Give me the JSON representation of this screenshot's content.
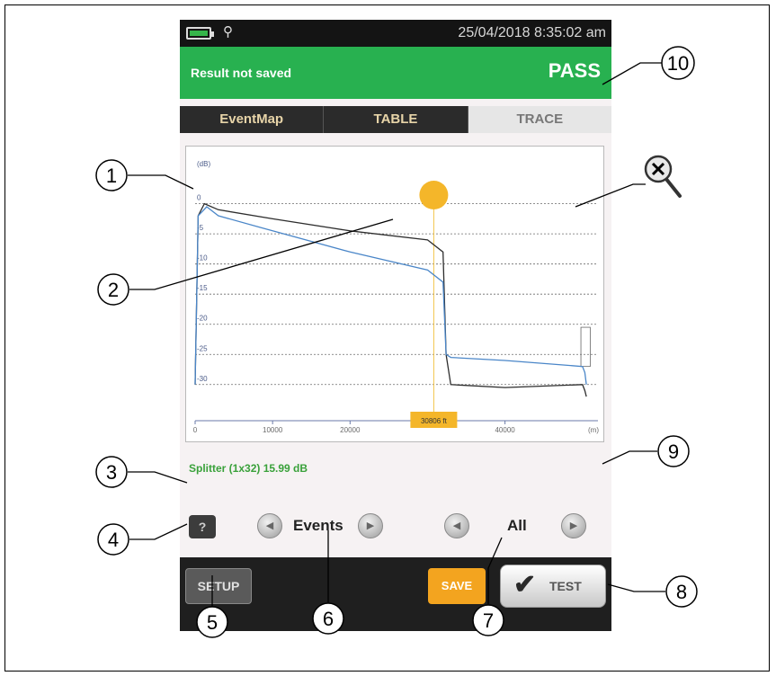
{
  "status_bar": {
    "datetime": "25/04/2018 8:35:02 am",
    "battery_icon": "battery-icon",
    "probe_icon": "probe-icon"
  },
  "result_bar": {
    "message": "Result not saved",
    "status": "PASS",
    "color": "#28b150"
  },
  "tabs": [
    {
      "label": "EventMap",
      "active": false
    },
    {
      "label": "TABLE",
      "active": false
    },
    {
      "label": "TRACE",
      "active": true
    }
  ],
  "chart_data": {
    "type": "line",
    "ylabel": "(dB)",
    "xlabel": "(m)",
    "y_ticks": [
      "0",
      "-5",
      "-10",
      "-15",
      "-20",
      "-25",
      "-30"
    ],
    "x_ticks": [
      "0",
      "10000",
      "20000",
      "40000"
    ],
    "ylim": [
      -36,
      8
    ],
    "xlim": [
      0,
      52000
    ],
    "cursor_position": "30806 ft",
    "cursor_x": 30806,
    "grid": true,
    "series": [
      {
        "color": "#2d2d2d",
        "x": [
          0,
          400,
          1200,
          3000,
          10000,
          20000,
          30000,
          32000,
          32400,
          33000,
          40000,
          50000,
          50300,
          50500
        ],
        "y": [
          -30,
          -2,
          0,
          -1,
          -2.5,
          -4.5,
          -6,
          -8,
          -25,
          -30,
          -30.5,
          -30,
          -31,
          -32
        ]
      },
      {
        "color": "#4a86c8",
        "x": [
          0,
          400,
          1500,
          3000,
          10000,
          20000,
          30000,
          32000,
          32400,
          33000,
          40000,
          50000,
          50300,
          50500
        ],
        "y": [
          -30,
          -2,
          -0.5,
          -2,
          -4.5,
          -8,
          -11,
          -13,
          -25,
          -25.5,
          -26,
          -27,
          -28,
          -30
        ]
      }
    ]
  },
  "event_info": "Splitter (1x32) 15.99 dB",
  "controls": {
    "help_label": "?",
    "events_label": "Events",
    "all_label": "All",
    "prev_icon": "chevron-left-icon",
    "next_icon": "chevron-right-icon"
  },
  "bottom_bar": {
    "setup_label": "SETUP",
    "save_label": "SAVE",
    "test_label": "TEST",
    "test_icon": "checkmark-icon"
  },
  "zoom_icon": "zoom-out-icon",
  "callouts": [
    "1",
    "2",
    "3",
    "4",
    "5",
    "6",
    "7",
    "8",
    "9",
    "10"
  ]
}
